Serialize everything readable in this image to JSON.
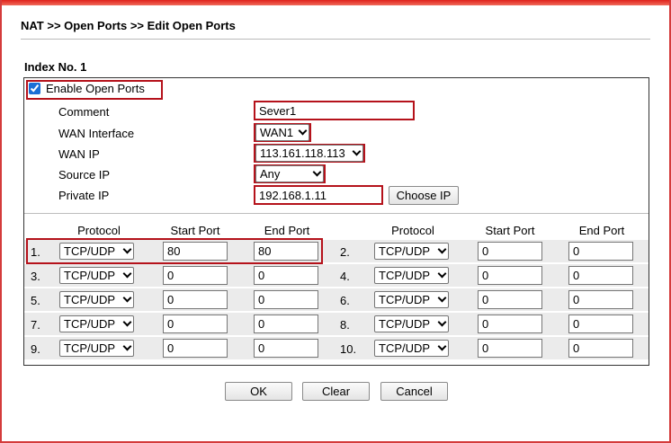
{
  "breadcrumb": "NAT >> Open Ports >> Edit Open Ports",
  "index_label": "Index No. 1",
  "enable": {
    "label": "Enable Open Ports",
    "checked": true
  },
  "fields": {
    "comment_label": "Comment",
    "comment_value": "Sever1",
    "wan_interface_label": "WAN Interface",
    "wan_interface_value": "WAN1",
    "wan_ip_label": "WAN IP",
    "wan_ip_value": "113.161.118.113",
    "source_ip_label": "Source IP",
    "source_ip_value": "Any",
    "private_ip_label": "Private IP",
    "private_ip_value": "192.168.1.11",
    "choose_ip_label": "Choose IP"
  },
  "columns": {
    "protocol": "Protocol",
    "start_port": "Start Port",
    "end_port": "End Port"
  },
  "rows": [
    {
      "num": "1.",
      "protocol": "TCP/UDP",
      "start": "80",
      "end": "80"
    },
    {
      "num": "2.",
      "protocol": "TCP/UDP",
      "start": "0",
      "end": "0"
    },
    {
      "num": "3.",
      "protocol": "TCP/UDP",
      "start": "0",
      "end": "0"
    },
    {
      "num": "4.",
      "protocol": "TCP/UDP",
      "start": "0",
      "end": "0"
    },
    {
      "num": "5.",
      "protocol": "TCP/UDP",
      "start": "0",
      "end": "0"
    },
    {
      "num": "6.",
      "protocol": "TCP/UDP",
      "start": "0",
      "end": "0"
    },
    {
      "num": "7.",
      "protocol": "TCP/UDP",
      "start": "0",
      "end": "0"
    },
    {
      "num": "8.",
      "protocol": "TCP/UDP",
      "start": "0",
      "end": "0"
    },
    {
      "num": "9.",
      "protocol": "TCP/UDP",
      "start": "0",
      "end": "0"
    },
    {
      "num": "10.",
      "protocol": "TCP/UDP",
      "start": "0",
      "end": "0"
    }
  ],
  "buttons": {
    "ok": "OK",
    "clear": "Clear",
    "cancel": "Cancel"
  },
  "colors": {
    "highlight": "#b5121b",
    "frame": "#d43b3b",
    "row_shade": "#ebebeb"
  }
}
